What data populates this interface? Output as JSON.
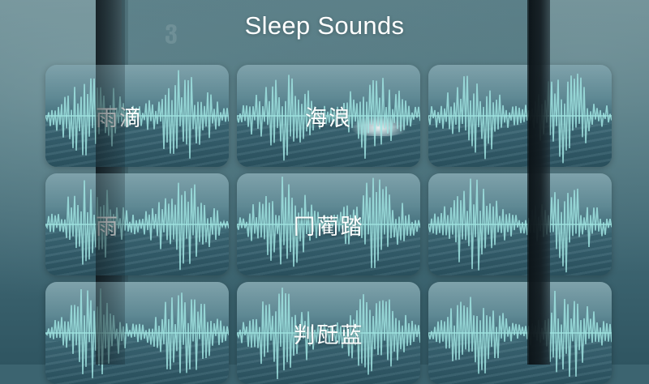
{
  "app": {
    "title": "Sleep Sounds"
  },
  "icons": {
    "app_icon": "app-logo-icon"
  },
  "accent": "#9fe3e0",
  "tiles": [
    {
      "label": "雨滴"
    },
    {
      "label": "海浪"
    },
    {
      "label": ""
    },
    {
      "label": "雨"
    },
    {
      "label": "冂蔺踏"
    },
    {
      "label": ""
    },
    {
      "label": ""
    },
    {
      "label": "判瓩蓝"
    },
    {
      "label": ""
    }
  ]
}
